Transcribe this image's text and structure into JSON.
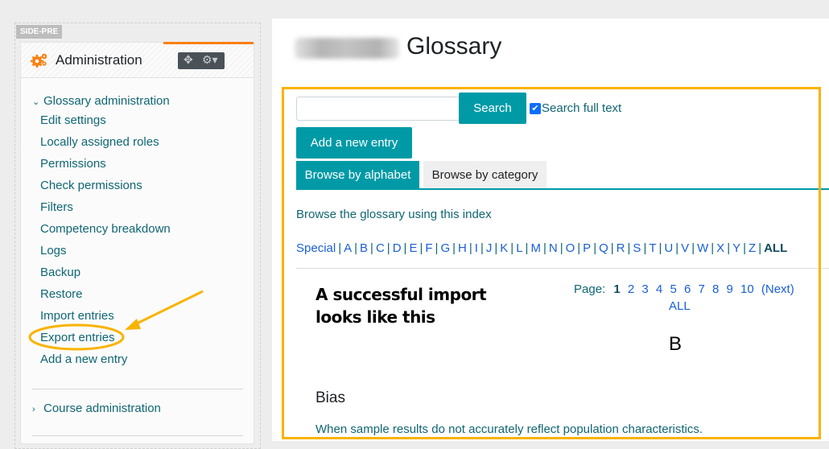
{
  "region_tag": "SIDE-PRE",
  "admin_block": {
    "title": "Administration",
    "icon": "cogs-icon",
    "controls": [
      "move-icon",
      "gear-menu-icon"
    ],
    "glossary_admin": {
      "label": "Glossary administration",
      "expanded": true,
      "items": [
        "Edit settings",
        "Locally assigned roles",
        "Permissions",
        "Check permissions",
        "Filters",
        "Competency breakdown",
        "Logs",
        "Backup",
        "Restore",
        "Import entries",
        "Export entries",
        "Add a new entry"
      ]
    },
    "course_admin": {
      "label": "Course administration",
      "expanded": false
    }
  },
  "main": {
    "title": "Glossary",
    "search": {
      "value": "",
      "placeholder": "",
      "button": "Search"
    },
    "fulltext": {
      "label": "Search full text",
      "checked": true
    },
    "add_button": "Add a new entry",
    "tabs": [
      {
        "label": "Browse by alphabet",
        "active": true
      },
      {
        "label": "Browse by category",
        "active": false
      }
    ],
    "browse_text": "Browse the glossary using this index",
    "alphabet": [
      "Special",
      "A",
      "B",
      "C",
      "D",
      "E",
      "F",
      "G",
      "H",
      "I",
      "J",
      "K",
      "L",
      "M",
      "N",
      "O",
      "P",
      "Q",
      "R",
      "S",
      "T",
      "U",
      "V",
      "W",
      "X",
      "Y",
      "Z",
      "ALL"
    ],
    "alphabet_current": "ALL",
    "paging": {
      "label": "Page:",
      "current": "1",
      "pages": [
        "2",
        "3",
        "4",
        "5",
        "6",
        "7",
        "8",
        "9",
        "10"
      ],
      "next": "(Next)",
      "all": "ALL"
    },
    "section_letter": "B",
    "entry": {
      "term": "Bias",
      "definition": "When sample results do not accurately reflect population characteristics."
    }
  },
  "annotation": {
    "text_line1": "A successful import",
    "text_line2": "looks like this",
    "highlight_color": "#f9b300",
    "highlighted_item": "Export entries"
  }
}
